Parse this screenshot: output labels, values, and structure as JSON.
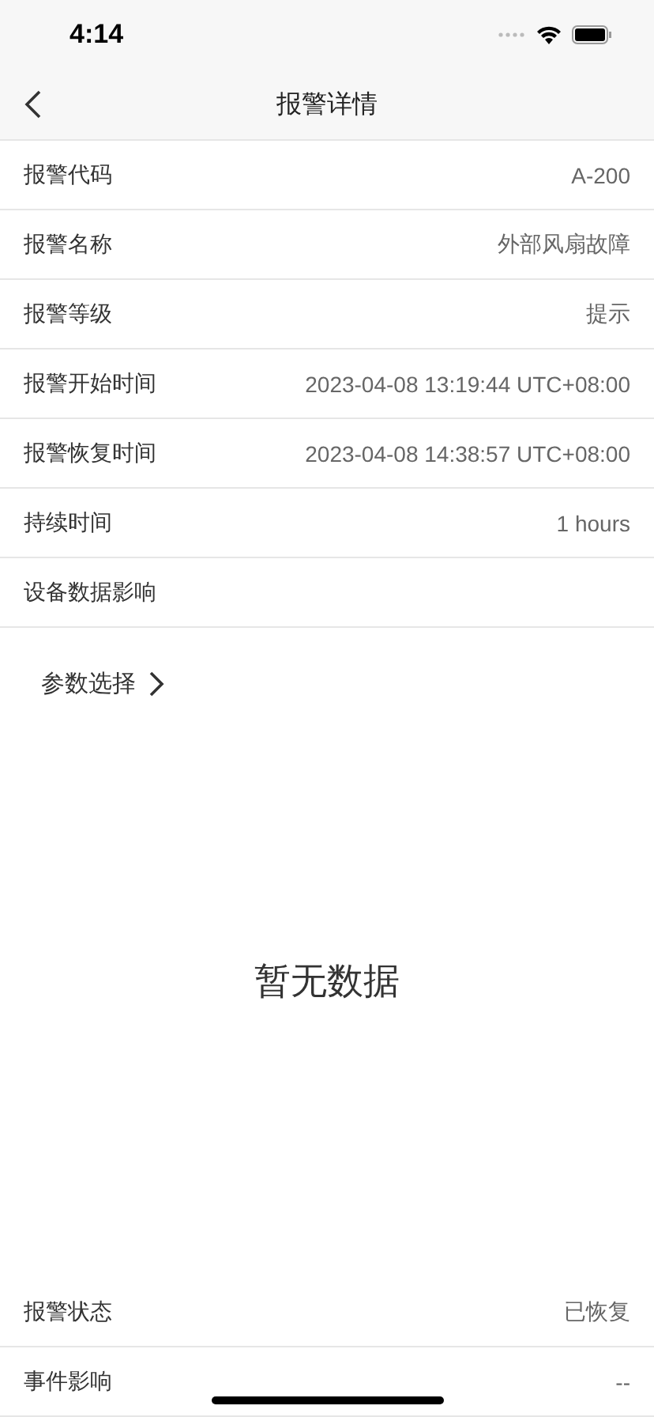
{
  "status_bar": {
    "time": "4:14"
  },
  "nav": {
    "title": "报警详情"
  },
  "details": [
    {
      "label": "报警代码",
      "value": "A-200"
    },
    {
      "label": "报警名称",
      "value": "外部风扇故障"
    },
    {
      "label": "报警等级",
      "value": "提示"
    },
    {
      "label": "报警开始时间",
      "value": "2023-04-08 13:19:44 UTC+08:00"
    },
    {
      "label": "报警恢复时间",
      "value": "2023-04-08 14:38:57 UTC+08:00"
    },
    {
      "label": "持续时间",
      "value": "1 hours"
    },
    {
      "label": "设备数据影响"
    }
  ],
  "param_select": {
    "label": "参数选择"
  },
  "empty_text": "暂无数据",
  "footer_rows": [
    {
      "label": "报警状态",
      "value": "已恢复"
    },
    {
      "label": "事件影响",
      "value": "--"
    }
  ]
}
